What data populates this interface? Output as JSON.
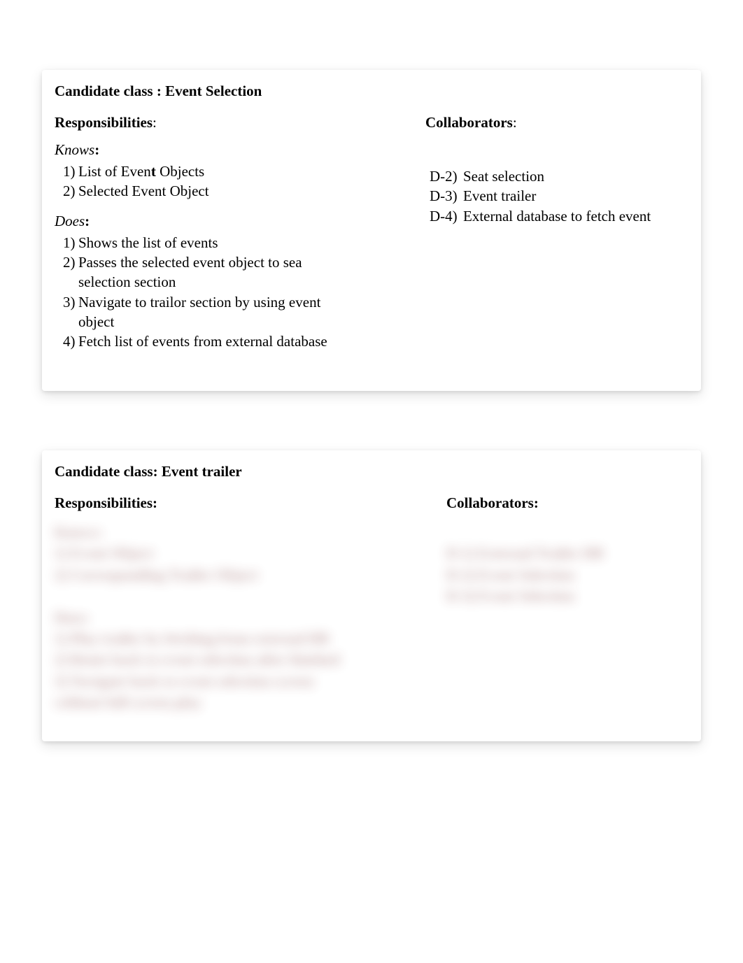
{
  "card1": {
    "title_prefix": "Candidate class :  ",
    "title_name": "Event Selection",
    "responsibilities_label": "Responsibilities",
    "collaborators_label": "Collaborators",
    "knows_label_italic": "Knows",
    "does_label_italic": "Does",
    "colon": ":",
    "bold_colon": ":",
    "knows_items": [
      {
        "num": "1)",
        "text_a": "List of Even",
        "text_bold": "t",
        "text_b": " Objects"
      },
      {
        "num": "2)",
        "text": "Selected Event Object"
      }
    ],
    "does_items": [
      {
        "num": "1)",
        "text": "Shows the list of events"
      },
      {
        "num": "2)",
        "text": "Passes the selected event object to sea selection section"
      },
      {
        "num": "3)",
        "text": "Navigate to trailor section by using event object"
      },
      {
        "num": "4)",
        "text": "Fetch list of events from external database"
      }
    ],
    "collaborators": [
      {
        "tag": "D-2)",
        "text": "Seat selection"
      },
      {
        "tag": "D-3)",
        "text": "Event trailer"
      },
      {
        "tag": "D-4)",
        "text": "External database to fetch event"
      }
    ]
  },
  "card2": {
    "title": "Candidate class: Event trailer",
    "responsibilities_label": "Responsibilities:",
    "collaborators_label": "Collaborators:",
    "blur_left": [
      "Knows:",
      "1) Event Object",
      "2) Corresponding Trailer Object",
      "",
      "Does:",
      "1) Play trailer by fetching from external DB",
      "2) Route back to event selection after finished",
      "3) Navigate back to event selection screen",
      "without full screen play"
    ],
    "blur_right": [
      "D-1) External Trailer DB",
      "D-2) Event Selection",
      "D-3) Event Selection"
    ]
  }
}
